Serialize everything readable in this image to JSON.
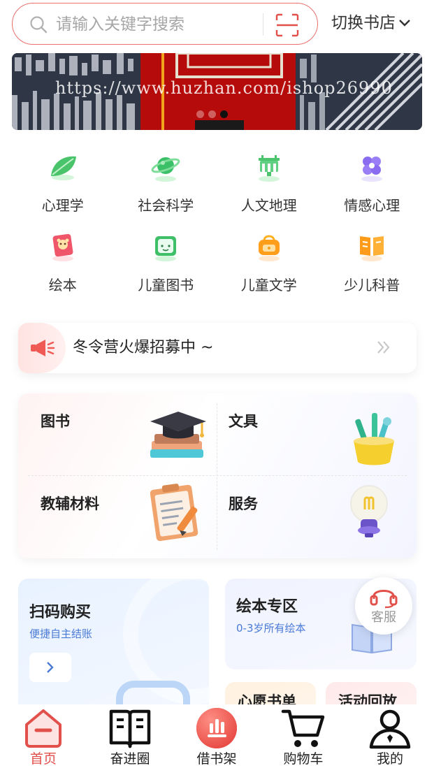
{
  "search": {
    "placeholder": "请输入关键字搜索"
  },
  "store_switch": {
    "label": "切换书店"
  },
  "banner": {
    "watermark": "https://www.huzhan.com/ishop26990",
    "slide_count": 3,
    "active_slide": 3
  },
  "categories": [
    {
      "label": "心理学",
      "icon": "leaf-icon"
    },
    {
      "label": "社会科学",
      "icon": "planet-icon"
    },
    {
      "label": "人文地理",
      "icon": "landmark-icon"
    },
    {
      "label": "情感心理",
      "icon": "clover-icon"
    },
    {
      "label": "绘本",
      "icon": "picture-book-icon"
    },
    {
      "label": "儿童图书",
      "icon": "kids-book-icon"
    },
    {
      "label": "儿童文学",
      "icon": "bag-icon"
    },
    {
      "label": "少儿科普",
      "icon": "open-book-icon"
    }
  ],
  "notice": {
    "text": "冬令营火爆招募中 ~",
    "icon": "megaphone-icon"
  },
  "grid": [
    {
      "label": "图书",
      "icon": "graduation-cap-icon"
    },
    {
      "label": "文具",
      "icon": "pencil-cup-icon"
    },
    {
      "label": "教辅材料",
      "icon": "clipboard-icon"
    },
    {
      "label": "服务",
      "icon": "lightbulb-icon"
    }
  ],
  "promo": {
    "scan": {
      "title": "扫码购买",
      "subtitle": "便捷自主结账"
    },
    "picture_books": {
      "title": "绘本专区",
      "subtitle": "0-3岁所有绘本"
    },
    "wish_list": {
      "title": "心愿书单"
    },
    "activity": {
      "title": "活动回放"
    }
  },
  "service": {
    "label": "客服"
  },
  "tabs": [
    {
      "label": "首页",
      "icon": "home-icon",
      "active": true
    },
    {
      "label": "奋进圈",
      "icon": "book-icon",
      "active": false
    },
    {
      "label": "借书架",
      "icon": "shelf-chart-icon",
      "active": false
    },
    {
      "label": "购物车",
      "icon": "cart-icon",
      "active": false
    },
    {
      "label": "我的",
      "icon": "user-icon",
      "active": false
    }
  ],
  "colors": {
    "accent": "#e2504b",
    "link_blue": "#4a7ad6"
  }
}
